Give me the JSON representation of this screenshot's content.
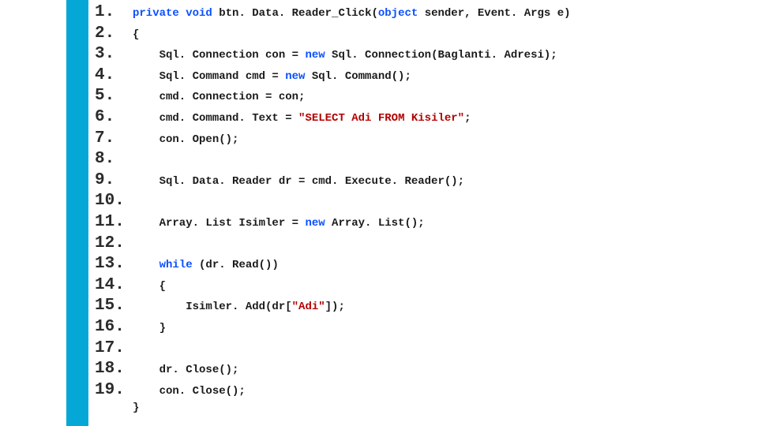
{
  "code": {
    "lines": [
      {
        "num": "1.",
        "tokens": [
          {
            "t": "private ",
            "c": "kw"
          },
          {
            "t": "void ",
            "c": "kw"
          },
          {
            "t": "btn. Data. Reader_Click(",
            "c": ""
          },
          {
            "t": "object ",
            "c": "kw"
          },
          {
            "t": "sender, Event. Args e)",
            "c": ""
          }
        ]
      },
      {
        "num": "2.",
        "tokens": [
          {
            "t": "{",
            "c": ""
          }
        ]
      },
      {
        "num": "3.",
        "tokens": [
          {
            "t": "    Sql. Connection con = ",
            "c": ""
          },
          {
            "t": "new ",
            "c": "kw"
          },
          {
            "t": "Sql. Connection(Baglanti. Adresi);",
            "c": ""
          }
        ]
      },
      {
        "num": "4.",
        "tokens": [
          {
            "t": "    Sql. Command cmd = ",
            "c": ""
          },
          {
            "t": "new ",
            "c": "kw"
          },
          {
            "t": "Sql. Command();",
            "c": ""
          }
        ]
      },
      {
        "num": "5.",
        "tokens": [
          {
            "t": "    cmd. Connection = con;",
            "c": ""
          }
        ]
      },
      {
        "num": "6.",
        "tokens": [
          {
            "t": "    cmd. Command. Text = ",
            "c": ""
          },
          {
            "t": "\"SELECT Adi FROM Kisiler\"",
            "c": "str"
          },
          {
            "t": ";",
            "c": ""
          }
        ]
      },
      {
        "num": "7.",
        "tokens": [
          {
            "t": "    con. Open();",
            "c": ""
          }
        ]
      },
      {
        "num": "8.",
        "tokens": []
      },
      {
        "num": "9.",
        "tokens": [
          {
            "t": "    Sql. Data. Reader dr = cmd. Execute. Reader();",
            "c": ""
          }
        ]
      },
      {
        "num": "10.",
        "tokens": []
      },
      {
        "num": "11.",
        "tokens": [
          {
            "t": "    Array. List Isimler = ",
            "c": ""
          },
          {
            "t": "new ",
            "c": "kw"
          },
          {
            "t": "Array. List();",
            "c": ""
          }
        ]
      },
      {
        "num": "12.",
        "tokens": []
      },
      {
        "num": "13.",
        "tokens": [
          {
            "t": "    ",
            "c": ""
          },
          {
            "t": "while ",
            "c": "kw"
          },
          {
            "t": "(dr. Read())",
            "c": ""
          }
        ]
      },
      {
        "num": "14.",
        "tokens": [
          {
            "t": "    {",
            "c": ""
          }
        ]
      },
      {
        "num": "15.",
        "tokens": [
          {
            "t": "        Isimler. Add(dr[",
            "c": ""
          },
          {
            "t": "\"Adi\"",
            "c": "str"
          },
          {
            "t": "]);",
            "c": ""
          }
        ]
      },
      {
        "num": "16.",
        "tokens": [
          {
            "t": "    }",
            "c": ""
          }
        ]
      },
      {
        "num": "17.",
        "tokens": []
      },
      {
        "num": "18.",
        "tokens": [
          {
            "t": "    dr. Close();",
            "c": ""
          }
        ]
      },
      {
        "num": "19.",
        "tokens": [
          {
            "t": "    con. Close();",
            "c": ""
          }
        ]
      },
      {
        "num": "",
        "tokens": [
          {
            "t": "}",
            "c": ""
          }
        ]
      }
    ]
  }
}
